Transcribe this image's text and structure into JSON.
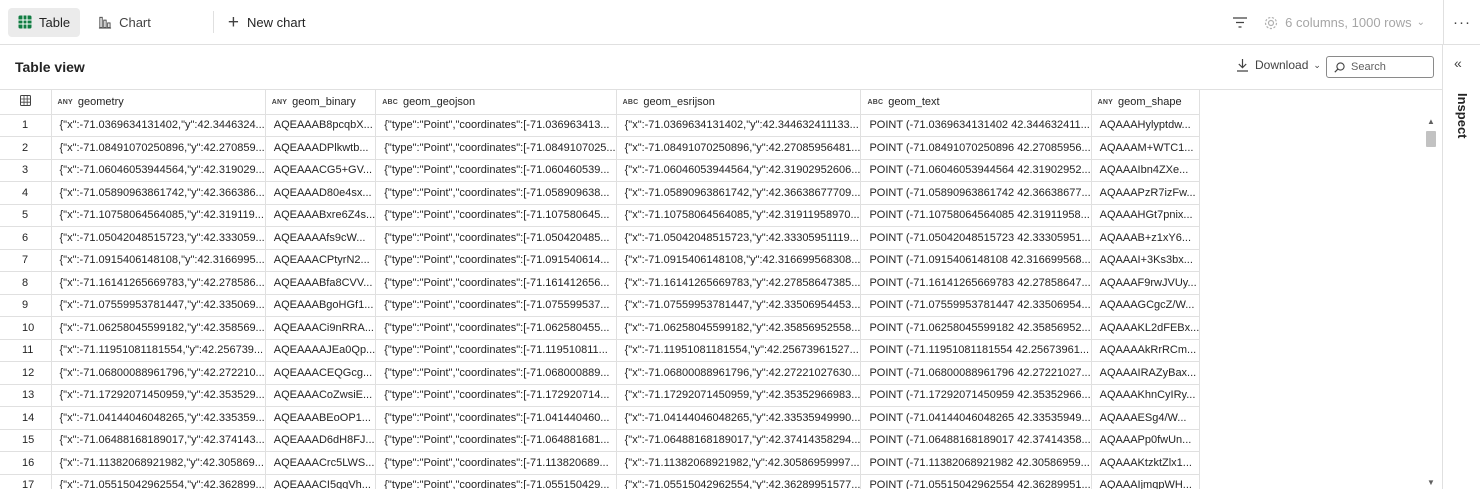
{
  "toolbar": {
    "tabs": [
      {
        "label": "Table",
        "icon": "table-grid-icon",
        "active": true
      },
      {
        "label": "Chart",
        "icon": "bar-chart-icon",
        "active": false
      }
    ],
    "new_chart_label": "New chart",
    "columns_info": "6 columns, 1000 rows",
    "more_label": "···"
  },
  "view": {
    "title": "Table view",
    "download_label": "Download",
    "search_placeholder": "Search"
  },
  "inspect": {
    "label": "Inspect",
    "collapse_icon": "«"
  },
  "table": {
    "columns": [
      {
        "type": "ANY",
        "name": "geometry"
      },
      {
        "type": "ANY",
        "name": "geom_binary"
      },
      {
        "type": "ABC",
        "name": "geom_geojson"
      },
      {
        "type": "ABC",
        "name": "geom_esrijson"
      },
      {
        "type": "ABC",
        "name": "geom_text"
      },
      {
        "type": "ANY",
        "name": "geom_shape"
      }
    ],
    "rows": [
      {
        "n": "1",
        "c": [
          "{\"x\":-71.0369634131402,\"y\":42.3446324...",
          "AQEAAAB8pcqbX...",
          "{\"type\":\"Point\",\"coordinates\":[-71.036963413...",
          "{\"x\":-71.0369634131402,\"y\":42.344632411133...",
          "POINT (-71.0369634131402 42.344632411...",
          "AQAAAHylyptdw..."
        ]
      },
      {
        "n": "2",
        "c": [
          "{\"x\":-71.08491070250896,\"y\":42.270859...",
          "AQEAAADPlkwtb...",
          "{\"type\":\"Point\",\"coordinates\":[-71.0849107025...",
          "{\"x\":-71.08491070250896,\"y\":42.27085956481...",
          "POINT (-71.08491070250896 42.27085956...",
          "AQAAAM+WTC1..."
        ]
      },
      {
        "n": "3",
        "c": [
          "{\"x\":-71.06046053944564,\"y\":42.319029...",
          "AQEAAACG5+GV...",
          "{\"type\":\"Point\",\"coordinates\":[-71.060460539...",
          "{\"x\":-71.06046053944564,\"y\":42.31902952606...",
          "POINT (-71.06046053944564 42.31902952...",
          "AQAAAIbn4ZXe..."
        ]
      },
      {
        "n": "4",
        "c": [
          "{\"x\":-71.05890963861742,\"y\":42.366386...",
          "AQEAAAD80e4sx...",
          "{\"type\":\"Point\",\"coordinates\":[-71.058909638...",
          "{\"x\":-71.05890963861742,\"y\":42.36638677709...",
          "POINT (-71.05890963861742 42.36638677...",
          "AQAAAPzR7izFw..."
        ]
      },
      {
        "n": "5",
        "c": [
          "{\"x\":-71.10758064564085,\"y\":42.319119...",
          "AQEAAABxre6Z4s...",
          "{\"type\":\"Point\",\"coordinates\":[-71.107580645...",
          "{\"x\":-71.10758064564085,\"y\":42.31911958970...",
          "POINT (-71.10758064564085 42.31911958...",
          "AQAAAHGt7pnix..."
        ]
      },
      {
        "n": "6",
        "c": [
          "{\"x\":-71.05042048515723,\"y\":42.333059...",
          "AQEAAAAfs9cW...",
          "{\"type\":\"Point\",\"coordinates\":[-71.050420485...",
          "{\"x\":-71.05042048515723,\"y\":42.33305951119...",
          "POINT (-71.05042048515723 42.33305951...",
          "AQAAAB+z1xY6..."
        ]
      },
      {
        "n": "7",
        "c": [
          "{\"x\":-71.0915406148108,\"y\":42.3166995...",
          "AQEAAACPtyrN2...",
          "{\"type\":\"Point\",\"coordinates\":[-71.091540614...",
          "{\"x\":-71.0915406148108,\"y\":42.316699568308...",
          "POINT (-71.0915406148108 42.316699568...",
          "AQAAAI+3Ks3bx..."
        ]
      },
      {
        "n": "8",
        "c": [
          "{\"x\":-71.16141265669783,\"y\":42.278586...",
          "AQEAAABfa8CVV...",
          "{\"type\":\"Point\",\"coordinates\":[-71.161412656...",
          "{\"x\":-71.16141265669783,\"y\":42.27858647385...",
          "POINT (-71.16141265669783 42.27858647...",
          "AQAAAF9rwJVUy..."
        ]
      },
      {
        "n": "9",
        "c": [
          "{\"x\":-71.07559953781447,\"y\":42.335069...",
          "AQEAAABgoHGf1...",
          "{\"type\":\"Point\",\"coordinates\":[-71.075599537...",
          "{\"x\":-71.07559953781447,\"y\":42.33506954453...",
          "POINT (-71.07559953781447 42.33506954...",
          "AQAAAGCgcZ/W..."
        ]
      },
      {
        "n": "10",
        "c": [
          "{\"x\":-71.06258045599182,\"y\":42.358569...",
          "AQEAAACi9nRRA...",
          "{\"type\":\"Point\",\"coordinates\":[-71.062580455...",
          "{\"x\":-71.06258045599182,\"y\":42.35856952558...",
          "POINT (-71.06258045599182 42.35856952...",
          "AQAAAKL2dFEBx..."
        ]
      },
      {
        "n": "11",
        "c": [
          "{\"x\":-71.11951081181554,\"y\":42.256739...",
          "AQEAAAAJEa0Qp...",
          "{\"type\":\"Point\",\"coordinates\":[-71.119510811...",
          "{\"x\":-71.11951081181554,\"y\":42.25673961527...",
          "POINT (-71.11951081181554 42.25673961...",
          "AQAAAAkRrRCm..."
        ]
      },
      {
        "n": "12",
        "c": [
          "{\"x\":-71.06800088961796,\"y\":42.272210...",
          "AQEAAACEQGcg...",
          "{\"type\":\"Point\",\"coordinates\":[-71.068000889...",
          "{\"x\":-71.06800088961796,\"y\":42.27221027630...",
          "POINT (-71.06800088961796 42.27221027...",
          "AQAAAIRAZyBax..."
        ]
      },
      {
        "n": "13",
        "c": [
          "{\"x\":-71.17292071450959,\"y\":42.353529...",
          "AQEAAACoZwsiE...",
          "{\"type\":\"Point\",\"coordinates\":[-71.172920714...",
          "{\"x\":-71.17292071450959,\"y\":42.35352966983...",
          "POINT (-71.17292071450959 42.35352966...",
          "AQAAAKhnCyIRy..."
        ]
      },
      {
        "n": "14",
        "c": [
          "{\"x\":-71.04144046048265,\"y\":42.335359...",
          "AQEAAABEoOP1...",
          "{\"type\":\"Point\",\"coordinates\":[-71.041440460...",
          "{\"x\":-71.04144046048265,\"y\":42.33535949990...",
          "POINT (-71.04144046048265 42.33535949...",
          "AQAAAESg4/W..."
        ]
      },
      {
        "n": "15",
        "c": [
          "{\"x\":-71.06488168189017,\"y\":42.374143...",
          "AQEAAAD6dH8FJ...",
          "{\"type\":\"Point\",\"coordinates\":[-71.064881681...",
          "{\"x\":-71.06488168189017,\"y\":42.37414358294...",
          "POINT (-71.06488168189017 42.37414358...",
          "AQAAAPp0fwUn..."
        ]
      },
      {
        "n": "16",
        "c": [
          "{\"x\":-71.11382068921982,\"y\":42.305869...",
          "AQEAAACrc5LWS...",
          "{\"type\":\"Point\",\"coordinates\":[-71.113820689...",
          "{\"x\":-71.11382068921982,\"y\":42.30586959997...",
          "POINT (-71.11382068921982 42.30586959...",
          "AQAAAKtzktZlx1..."
        ]
      },
      {
        "n": "17",
        "c": [
          "{\"x\":-71.05515042962554,\"y\":42.362899...",
          "AQEAAACI5qqVh...",
          "{\"type\":\"Point\",\"coordinates\":[-71.055150429...",
          "{\"x\":-71.05515042962554,\"y\":42.36289951577...",
          "POINT (-71.05515042962554 42.36289951...",
          "AQAAAIjmqpWH..."
        ]
      }
    ]
  }
}
